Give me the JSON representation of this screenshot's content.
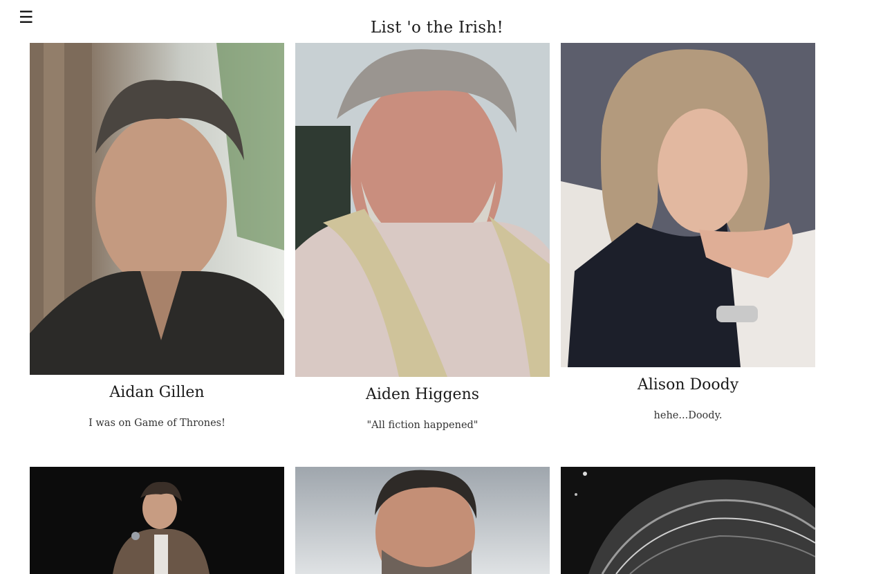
{
  "header": {
    "menu_icon": "☰",
    "title": "List 'o the Irish!"
  },
  "cards": [
    {
      "name": "Aidan Gillen",
      "quote": "I was on Game of Thrones!",
      "photo": "portrait-man-dark-shirt-tree"
    },
    {
      "name": "Aiden Higgens",
      "quote": "\"All fiction happened\"",
      "photo": "portrait-bearded-man-striped-shirt"
    },
    {
      "name": "Alison Doody",
      "quote": "hehe...Doody.",
      "photo": "portrait-woman-blonde-hair"
    },
    {
      "name": "",
      "quote": "",
      "photo": "man-with-microphone-on-stage"
    },
    {
      "name": "",
      "quote": "",
      "photo": "bearded-man-cloudy-sky"
    },
    {
      "name": "",
      "quote": "",
      "photo": "black-and-white-hair-closeup"
    }
  ]
}
